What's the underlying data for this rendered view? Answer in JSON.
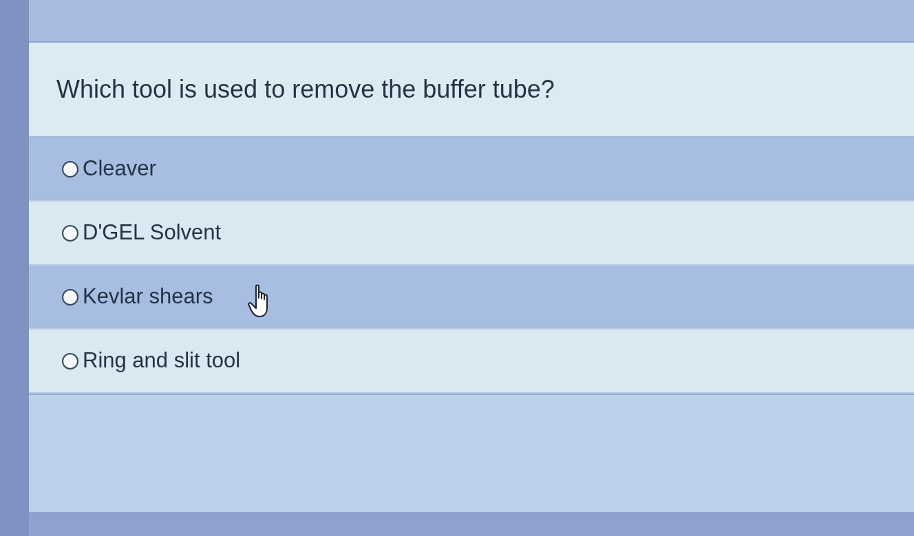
{
  "question": {
    "text": "Which tool is used to remove the buffer tube?"
  },
  "options": [
    {
      "label": "Cleaver",
      "selected": false,
      "hovered": false
    },
    {
      "label": "D'GEL Solvent",
      "selected": false,
      "hovered": false
    },
    {
      "label": "Kevlar shears",
      "selected": false,
      "hovered": true
    },
    {
      "label": "Ring and slit tool",
      "selected": false,
      "hovered": false
    }
  ]
}
